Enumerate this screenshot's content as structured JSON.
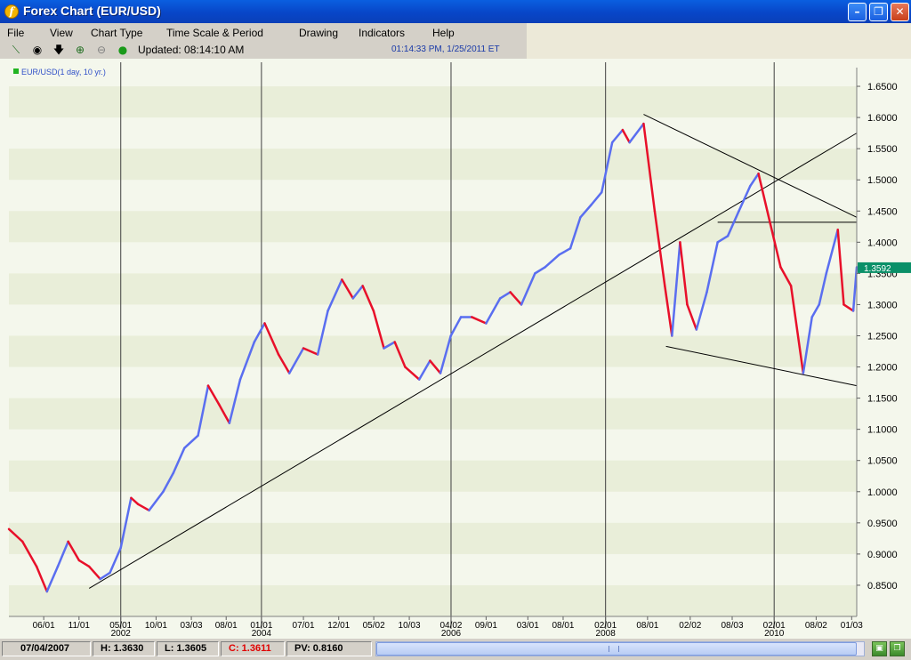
{
  "window": {
    "title": "Forex Chart (EUR/USD)",
    "app_icon_glyph": "f"
  },
  "menu": [
    {
      "label": "File"
    },
    {
      "label": "View"
    },
    {
      "label": "Chart Type"
    },
    {
      "label": "Time Scale & Period"
    },
    {
      "label": "Drawing"
    },
    {
      "label": "Indicators"
    },
    {
      "label": "Help"
    }
  ],
  "toolbar": {
    "tools": [
      "line-tool-icon",
      "crosshair-icon",
      "down-arrow-icon",
      "zoom-in-icon",
      "zoom-out-icon",
      "green-dot-icon"
    ],
    "updated_label": "Updated: 08:14:10 AM",
    "timestamp": "01:14:33 PM, 1/25/2011 ET"
  },
  "chart_data": {
    "type": "line",
    "legend": "EUR/USD(1 day, 10 yr.)",
    "legend_placement": "top-left",
    "legend_color": "#22b422",
    "y_axis": {
      "side": "right",
      "range": [
        0.8,
        1.68
      ],
      "ticks": [
        "1.6500",
        "1.6000",
        "1.5500",
        "1.5000",
        "1.4500",
        "1.4000",
        "1.3500",
        "1.3000",
        "1.2500",
        "1.2000",
        "1.1500",
        "1.1000",
        "1.0500",
        "1.0000",
        "0.9500",
        "0.9000",
        "0.8500"
      ]
    },
    "x_axis": {
      "ticks": [
        "06/01",
        "11/01",
        "05/01",
        "10/01",
        "03/03",
        "08/01",
        "01/01",
        "07/01",
        "12/01",
        "05/02",
        "10/03",
        "04/02",
        "09/01",
        "03/01",
        "08/01",
        "02/01",
        "08/01",
        "02/02",
        "08/03",
        "02/01",
        "08/02",
        "01/03"
      ],
      "years": [
        "2002",
        "2004",
        "2006",
        "2008",
        "2010"
      ]
    },
    "series_colors": {
      "up": "#5a6ef0",
      "down": "#e8102a"
    },
    "series": [
      {
        "x": [
          "2001-01-01",
          "2001-03-01",
          "2001-05-01",
          "2001-06-15",
          "2001-08-01",
          "2001-09-15",
          "2001-11-01",
          "2001-12-15",
          "2002-02-01",
          "2002-03-15",
          "2002-05-01",
          "2002-06-15",
          "2002-07-15",
          "2002-09-01",
          "2002-11-01",
          "2002-12-15",
          "2003-02-01",
          "2003-04-01",
          "2003-05-15",
          "2003-07-01",
          "2003-08-15",
          "2003-10-01",
          "2003-12-01",
          "2004-01-15",
          "2004-03-15",
          "2004-05-01",
          "2004-07-01",
          "2004-09-01",
          "2004-10-15",
          "2004-12-15",
          "2005-02-01",
          "2005-03-15",
          "2005-05-01",
          "2005-06-15",
          "2005-08-01",
          "2005-09-15",
          "2005-11-15",
          "2006-01-01",
          "2006-02-15",
          "2006-04-01",
          "2006-05-15",
          "2006-07-01",
          "2006-09-01",
          "2006-11-01",
          "2006-12-15",
          "2007-02-01",
          "2007-04-01",
          "2007-05-15",
          "2007-07-15",
          "2007-09-01",
          "2007-10-15",
          "2007-12-01",
          "2008-01-15",
          "2008-03-01",
          "2008-04-15",
          "2008-05-15",
          "2008-07-15",
          "2008-09-01",
          "2008-10-15",
          "2008-11-15",
          "2008-12-20",
          "2009-01-20",
          "2009-03-01",
          "2009-04-15",
          "2009-06-01",
          "2009-07-15",
          "2009-09-01",
          "2009-10-20",
          "2009-11-25",
          "2010-01-15",
          "2010-03-01",
          "2010-04-15",
          "2010-06-07",
          "2010-07-15",
          "2010-08-15",
          "2010-09-15",
          "2010-11-04",
          "2010-11-30",
          "2011-01-10",
          "2011-01-25"
        ],
        "y": [
          0.94,
          0.92,
          0.88,
          0.84,
          0.88,
          0.92,
          0.89,
          0.88,
          0.86,
          0.87,
          0.91,
          0.99,
          0.98,
          0.97,
          1.0,
          1.03,
          1.07,
          1.09,
          1.17,
          1.14,
          1.11,
          1.18,
          1.24,
          1.27,
          1.22,
          1.19,
          1.23,
          1.22,
          1.29,
          1.34,
          1.31,
          1.33,
          1.29,
          1.23,
          1.24,
          1.2,
          1.18,
          1.21,
          1.19,
          1.25,
          1.28,
          1.28,
          1.27,
          1.31,
          1.32,
          1.3,
          1.35,
          1.36,
          1.38,
          1.39,
          1.44,
          1.46,
          1.48,
          1.56,
          1.58,
          1.56,
          1.59,
          1.45,
          1.33,
          1.25,
          1.4,
          1.3,
          1.26,
          1.32,
          1.4,
          1.41,
          1.45,
          1.49,
          1.51,
          1.43,
          1.36,
          1.33,
          1.19,
          1.28,
          1.3,
          1.35,
          1.42,
          1.3,
          1.29,
          1.36
        ]
      }
    ],
    "trendlines": [
      {
        "from": [
          "2001-12-15",
          0.845
        ],
        "to": [
          "2011-01-25",
          1.575
        ]
      },
      {
        "from": [
          "2008-07-15",
          1.605
        ],
        "to": [
          "2011-01-25",
          1.44
        ]
      },
      {
        "from": [
          "2008-10-20",
          1.233
        ],
        "to": [
          "2011-01-25",
          1.17
        ]
      },
      {
        "from": [
          "2009-06-01",
          1.432
        ],
        "to": [
          "2011-01-25",
          1.432
        ]
      }
    ],
    "last_price_label": "1.3592",
    "last_price_color": "#0a9068"
  },
  "status": {
    "date": "07/04/2007",
    "high": "H: 1.3630",
    "low": "L: 1.3605",
    "close": "C: 1.3611",
    "pv": "PV: 0.8160"
  }
}
